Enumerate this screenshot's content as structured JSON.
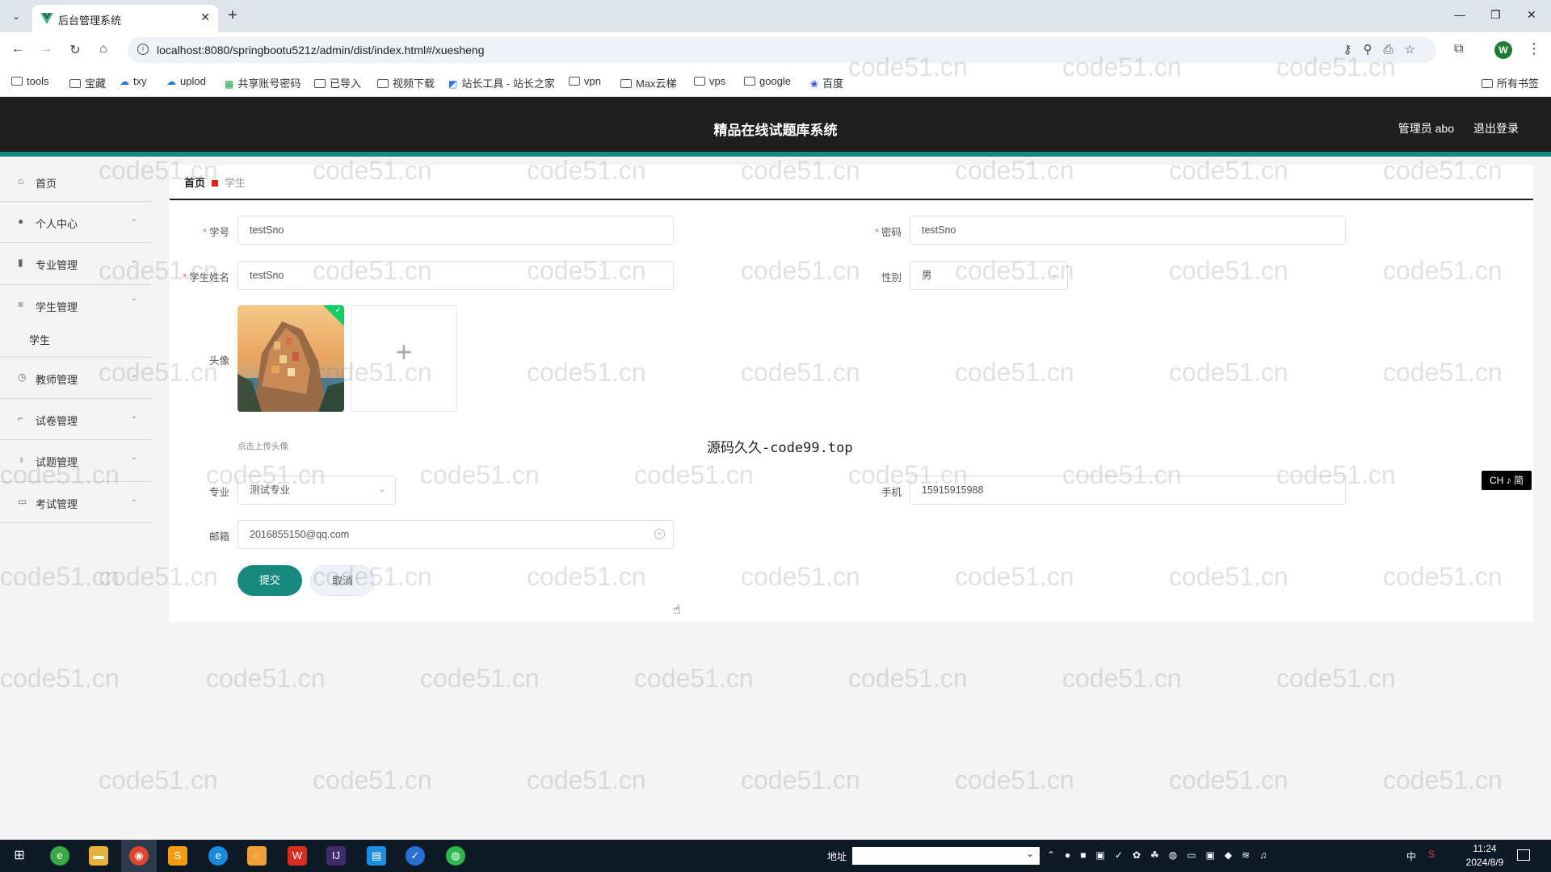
{
  "browser": {
    "tab_title": "后台管理系统",
    "url": "localhost:8080/springbootu521z/admin/dist/index.html#/xuesheng",
    "profile_initial": "W",
    "bookmarks": [
      "tools",
      "宝藏",
      "txy",
      "uplod",
      "共享账号密码",
      "已导入",
      "视频下载",
      "站长工具 - 站长之家",
      "vpn",
      "Max云梯",
      "vps",
      "google",
      "百度"
    ],
    "all_bookmarks": "所有书签"
  },
  "header": {
    "title": "精品在线试题库系统",
    "user": "管理员 abo",
    "logout": "退出登录"
  },
  "sidebar": {
    "items": [
      {
        "label": "首页",
        "icon": "home-icon",
        "expanded": false
      },
      {
        "label": "个人中心",
        "icon": "user-icon",
        "expanded": false
      },
      {
        "label": "专业管理",
        "icon": "book-icon",
        "expanded": false
      },
      {
        "label": "学生管理",
        "icon": "list-icon",
        "expanded": true
      },
      {
        "label": "教师管理",
        "icon": "clock-icon",
        "expanded": false
      },
      {
        "label": "试卷管理",
        "icon": "crop-icon",
        "expanded": false
      },
      {
        "label": "试题管理",
        "icon": "mic-icon",
        "expanded": false
      },
      {
        "label": "考试管理",
        "icon": "monitor-icon",
        "expanded": false
      }
    ],
    "sub_item": "学生"
  },
  "breadcrumb": {
    "home": "首页",
    "current": "学生"
  },
  "form": {
    "student_no": {
      "label": "学号",
      "value": "testSno"
    },
    "password": {
      "label": "密码",
      "value": "testSno"
    },
    "name": {
      "label": "学生姓名",
      "value": "testSno"
    },
    "gender": {
      "label": "性别",
      "value": "男"
    },
    "avatar": {
      "label": "头像",
      "tip": "点击上传头像"
    },
    "major": {
      "label": "专业",
      "value": "测试专业"
    },
    "phone": {
      "label": "手机",
      "value": "15915915988"
    },
    "email": {
      "label": "邮箱",
      "value": "2016855150@qq.com"
    },
    "submit": "提交",
    "cancel": "取消"
  },
  "overlay_text": "源码久久-code99.top",
  "watermark": "code51.cn",
  "ime_indicator": "CH ♪ 简",
  "taskbar": {
    "address_label": "地址",
    "time": "11:24",
    "date": "2024/8/9",
    "tray_lang": "中"
  },
  "colors": {
    "accent": "#17887d",
    "header_bg": "#1f1f1f",
    "header_stripe": "#138a7f",
    "crumb_marker": "#e0221b"
  }
}
